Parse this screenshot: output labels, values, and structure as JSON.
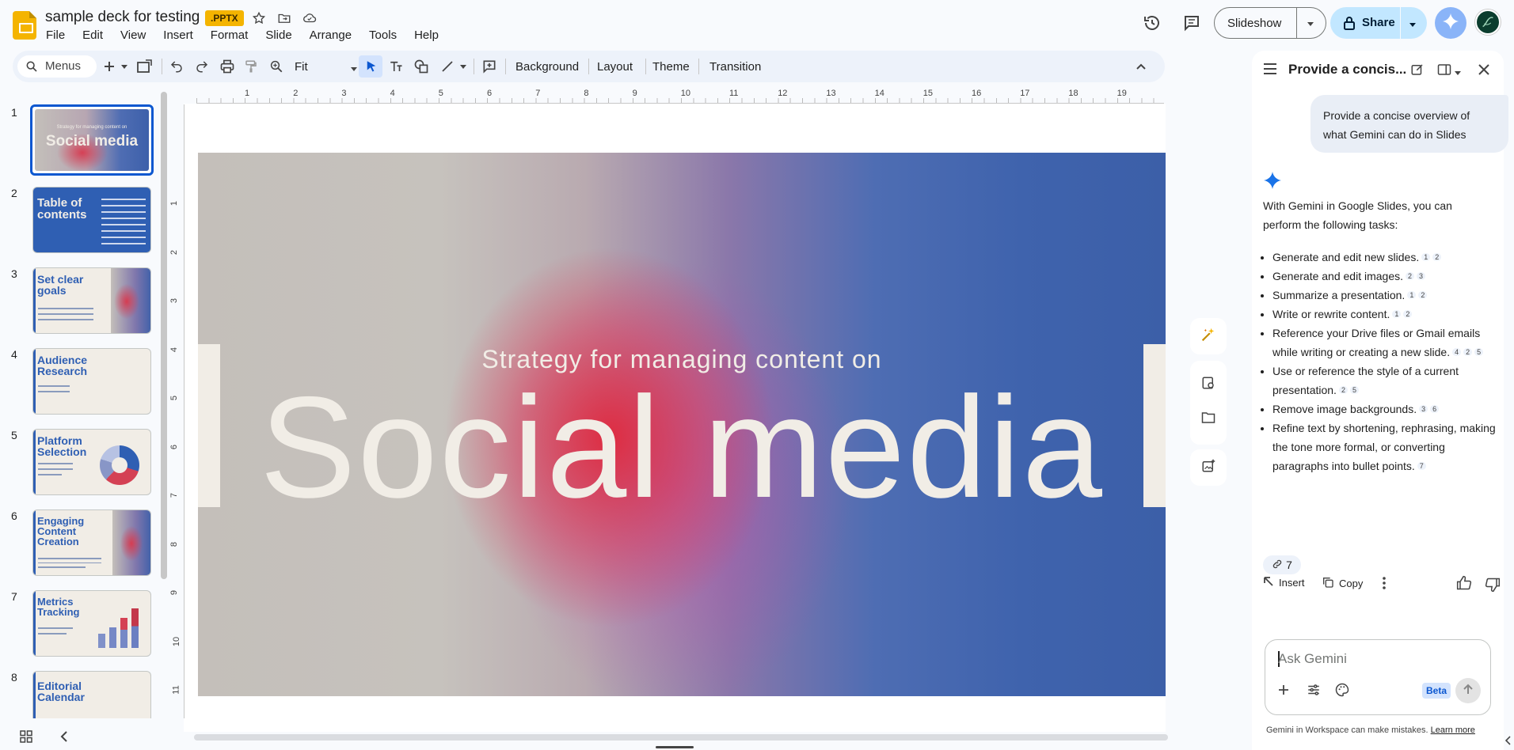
{
  "header": {
    "doc_title": "sample deck for testing",
    "file_badge": ".PPTX",
    "slideshow_label": "Slideshow",
    "share_label": "Share"
  },
  "menu": [
    "File",
    "Edit",
    "View",
    "Insert",
    "Format",
    "Slide",
    "Arrange",
    "Tools",
    "Help"
  ],
  "toolbar": {
    "menus_label": "Menus",
    "zoom_value": "Fit",
    "background_label": "Background",
    "layout_label": "Layout",
    "theme_label": "Theme",
    "transition_label": "Transition"
  },
  "ruler_h": [
    "1",
    "2",
    "3",
    "4",
    "5",
    "6",
    "7",
    "8",
    "9",
    "10",
    "11",
    "12",
    "13",
    "14",
    "15",
    "16",
    "17",
    "18",
    "19"
  ],
  "ruler_v": [
    "1",
    "2",
    "3",
    "4",
    "5",
    "6",
    "7",
    "8",
    "9",
    "10",
    "11"
  ],
  "slides": [
    {
      "num": "1",
      "title": "Social media",
      "pre": "Strategy for managing content on"
    },
    {
      "num": "2",
      "title": "Table of contents"
    },
    {
      "num": "3",
      "title": "Set clear goals"
    },
    {
      "num": "4",
      "title": "Audience Research"
    },
    {
      "num": "5",
      "title": "Platform Selection"
    },
    {
      "num": "6",
      "title": "Engaging Content Creation"
    },
    {
      "num": "7",
      "title": "Metrics Tracking"
    },
    {
      "num": "8",
      "title": "Editorial Calendar"
    }
  ],
  "slide": {
    "subtitle": "Strategy for managing content on",
    "title": "Social media"
  },
  "gemini": {
    "panel_title": "Provide a concis...",
    "prompt": "Provide a concise overview of what Gemini can do in Slides",
    "intro": "With Gemini in Google Slides, you can perform the following tasks:",
    "items": [
      {
        "text": "Generate and edit new slides.",
        "refs": [
          "1",
          "2"
        ]
      },
      {
        "text": "Generate and edit images.",
        "refs": [
          "2",
          "3"
        ]
      },
      {
        "text": "Summarize a presentation.",
        "refs": [
          "1",
          "2"
        ]
      },
      {
        "text": "Write or rewrite content.",
        "refs": [
          "1",
          "2"
        ]
      },
      {
        "text": "Reference your Drive files or Gmail emails while writing or creating a new slide.",
        "refs": [
          "4",
          "2",
          "5"
        ]
      },
      {
        "text": "Use or reference the style of a current presentation.",
        "refs": [
          "2",
          "5"
        ]
      },
      {
        "text": "Remove image backgrounds.",
        "refs": [
          "3",
          "6"
        ]
      },
      {
        "text": "Refine text by shortening, rephrasing, making the tone more formal, or converting paragraphs into bullet points.",
        "refs": [
          "7"
        ]
      }
    ],
    "source_count": "7",
    "insert_label": "Insert",
    "copy_label": "Copy",
    "ask_placeholder": "Ask Gemini",
    "beta_label": "Beta",
    "footer_text": "Gemini in Workspace can make mistakes.",
    "learn_more": "Learn more"
  },
  "colors": {
    "accent": "#0b57d0",
    "share_bg": "#c2e7ff",
    "logo": "#f4b400",
    "slide_text": "#f1ede6",
    "thumb_blue": "#2f5fb3"
  }
}
